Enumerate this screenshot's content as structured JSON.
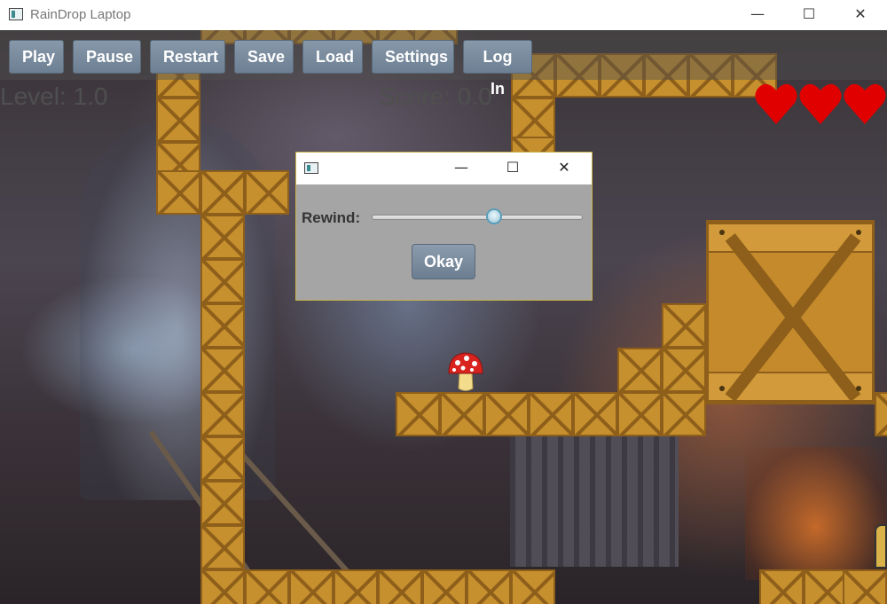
{
  "window": {
    "title": "RainDrop Laptop",
    "minimize_glyph": "—",
    "maximize_glyph": "☐",
    "close_glyph": "✕"
  },
  "toolbar": {
    "buttons": [
      {
        "id": "play",
        "label": "Play"
      },
      {
        "id": "pause",
        "label": "Pause"
      },
      {
        "id": "restart",
        "label": "Restart"
      },
      {
        "id": "save",
        "label": "Save"
      },
      {
        "id": "load",
        "label": "Load"
      },
      {
        "id": "settings",
        "label": "Settings"
      },
      {
        "id": "login",
        "label": "Log In"
      }
    ]
  },
  "hud": {
    "level": "Level: 1.0",
    "score": "Score: 0.0",
    "lives": 3
  },
  "dialog": {
    "minimize_glyph": "—",
    "maximize_glyph": "☐",
    "close_glyph": "✕",
    "rewind_label": "Rewind:",
    "rewind_value": 0.58,
    "okay_label": "Okay"
  },
  "colors": {
    "heart": "#e00000",
    "crate": "#c7902f",
    "crate_border": "#8e5f1a",
    "button": "#7a8c9f",
    "dialog_bg": "#a5a5a5"
  },
  "icons": [
    "app-icon",
    "heart-icon",
    "mushroom-icon",
    "door-icon"
  ]
}
